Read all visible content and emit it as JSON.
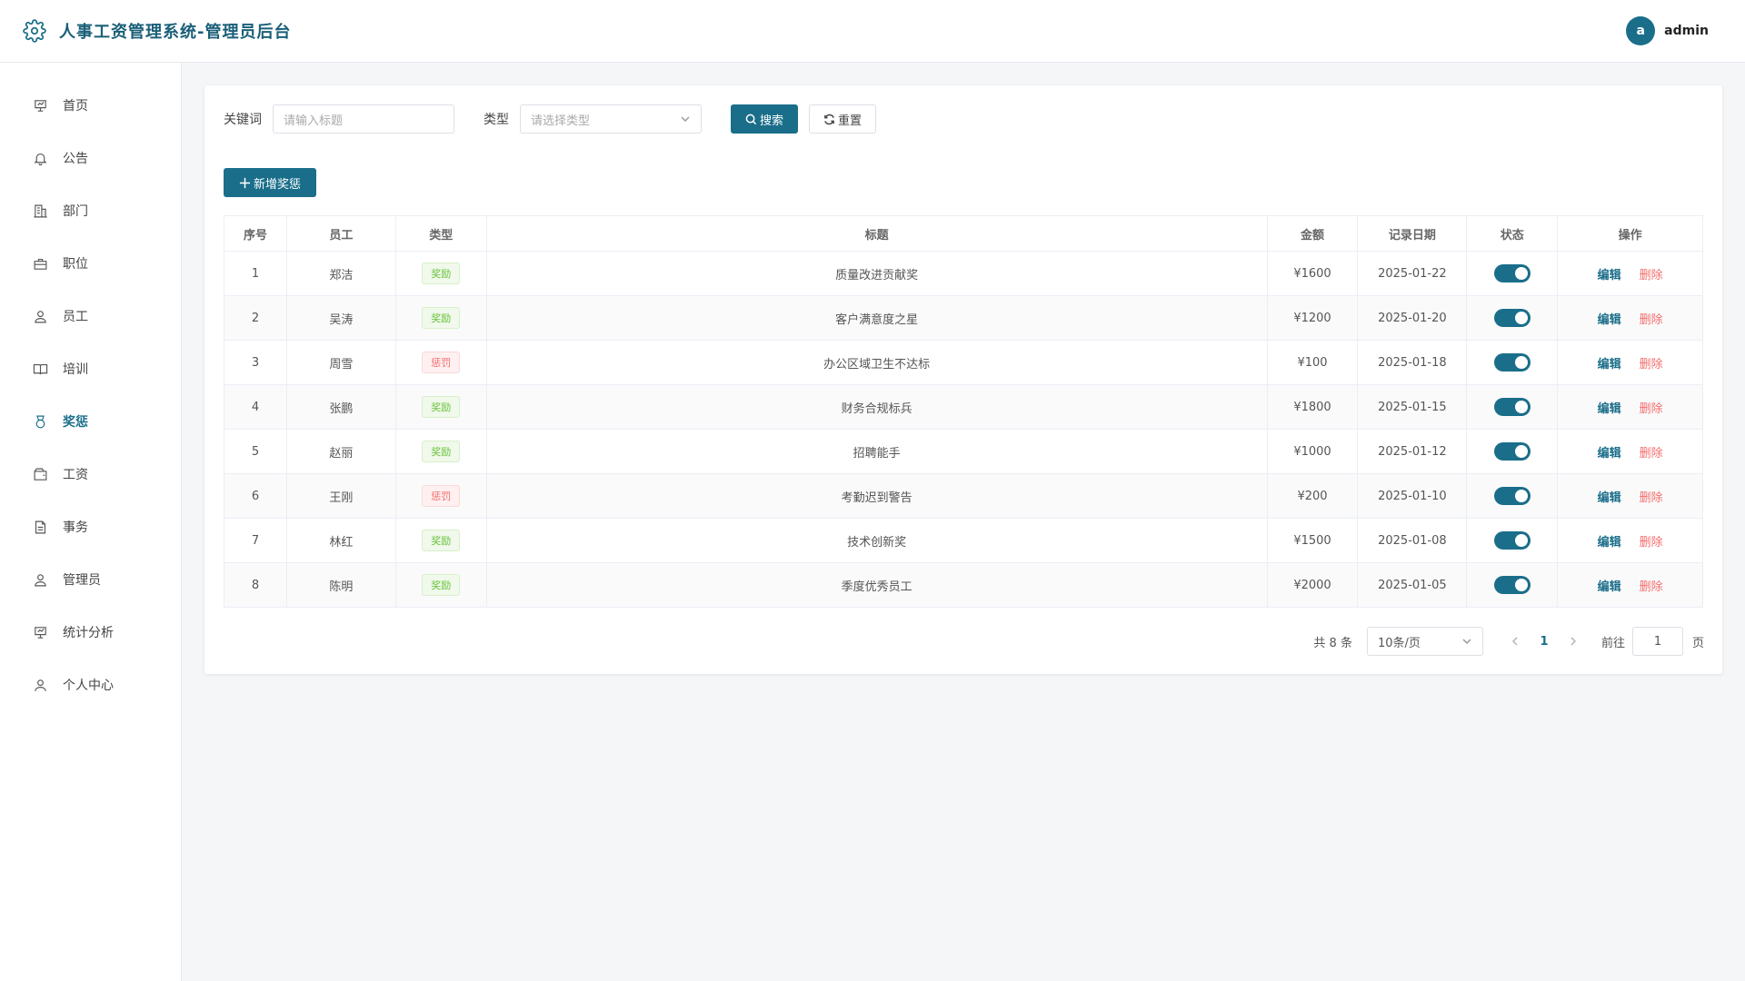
{
  "header": {
    "title": "人事工资管理系统-管理员后台",
    "logo_icon": "gear-icon",
    "avatar_letter": "a",
    "username": "admin"
  },
  "sidebar": {
    "items": [
      {
        "label": "首页",
        "icon": "dashboard-icon"
      },
      {
        "label": "公告",
        "icon": "bell-icon"
      },
      {
        "label": "部门",
        "icon": "building-icon"
      },
      {
        "label": "职位",
        "icon": "briefcase-icon"
      },
      {
        "label": "员工",
        "icon": "user-icon"
      },
      {
        "label": "培训",
        "icon": "book-icon"
      },
      {
        "label": "奖惩",
        "icon": "medal-icon",
        "active": true
      },
      {
        "label": "工资",
        "icon": "wallet-icon"
      },
      {
        "label": "事务",
        "icon": "document-icon"
      },
      {
        "label": "管理员",
        "icon": "admin-icon"
      },
      {
        "label": "统计分析",
        "icon": "chart-icon"
      },
      {
        "label": "个人中心",
        "icon": "profile-icon"
      }
    ]
  },
  "filter": {
    "keyword_label": "关键词",
    "keyword_placeholder": "请输入标题",
    "type_label": "类型",
    "type_placeholder": "请选择类型",
    "search_label": "搜索",
    "reset_label": "重置"
  },
  "add_button": "新增奖惩",
  "table": {
    "headers": [
      "序号",
      "员工",
      "类型",
      "标题",
      "金额",
      "记录日期",
      "状态",
      "操作"
    ],
    "edit_label": "编辑",
    "delete_label": "删除",
    "rows": [
      {
        "no": "1",
        "employee": "郑洁",
        "type": "奖励",
        "kind": "reward",
        "title": "质量改进贡献奖",
        "amount": "¥1600",
        "date": "2025-01-22",
        "status": true
      },
      {
        "no": "2",
        "employee": "吴涛",
        "type": "奖励",
        "kind": "reward",
        "title": "客户满意度之星",
        "amount": "¥1200",
        "date": "2025-01-20",
        "status": true
      },
      {
        "no": "3",
        "employee": "周雪",
        "type": "惩罚",
        "kind": "punish",
        "title": "办公区域卫生不达标",
        "amount": "¥100",
        "date": "2025-01-18",
        "status": true
      },
      {
        "no": "4",
        "employee": "张鹏",
        "type": "奖励",
        "kind": "reward",
        "title": "财务合规标兵",
        "amount": "¥1800",
        "date": "2025-01-15",
        "status": true
      },
      {
        "no": "5",
        "employee": "赵丽",
        "type": "奖励",
        "kind": "reward",
        "title": "招聘能手",
        "amount": "¥1000",
        "date": "2025-01-12",
        "status": true
      },
      {
        "no": "6",
        "employee": "王刚",
        "type": "惩罚",
        "kind": "punish",
        "title": "考勤迟到警告",
        "amount": "¥200",
        "date": "2025-01-10",
        "status": true
      },
      {
        "no": "7",
        "employee": "林红",
        "type": "奖励",
        "kind": "reward",
        "title": "技术创新奖",
        "amount": "¥1500",
        "date": "2025-01-08",
        "status": true
      },
      {
        "no": "8",
        "employee": "陈明",
        "type": "奖励",
        "kind": "reward",
        "title": "季度优秀员工",
        "amount": "¥2000",
        "date": "2025-01-05",
        "status": true
      }
    ]
  },
  "pagination": {
    "total": "共 8 条",
    "page_size": "10条/页",
    "current_page": "1",
    "goto_label": "前往",
    "goto_value": "1",
    "page_unit": "页"
  },
  "colors": {
    "primary": "#1a6e8a",
    "reward": "#67c23a",
    "punish": "#f56c6c"
  }
}
